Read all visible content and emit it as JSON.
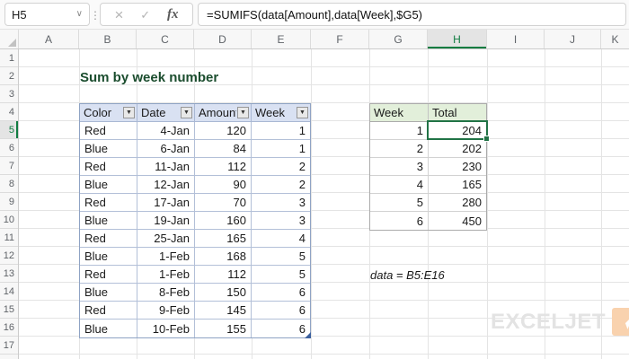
{
  "formula_bar": {
    "name_box_value": "H5",
    "name_box_dropdown_icon": "∨",
    "separator_icon": "⋮",
    "cancel_icon": "×",
    "enter_icon": "✓",
    "fx_icon": "fx",
    "formula": "=SUMIFS(data[Amount],data[Week],$G5)"
  },
  "sheet": {
    "column_headers": [
      "A",
      "B",
      "C",
      "D",
      "E",
      "F",
      "G",
      "H",
      "I",
      "J",
      "K"
    ],
    "selected_column": "H",
    "row_headers": [
      "1",
      "2",
      "3",
      "4",
      "5",
      "6",
      "7",
      "8",
      "9",
      "10",
      "11",
      "12",
      "13",
      "14",
      "15",
      "16",
      "17"
    ],
    "selected_row": "5",
    "active_cell": "H5"
  },
  "content": {
    "title": "Sum by week number",
    "note": "data = B5:E16"
  },
  "data_table": {
    "name": "data",
    "headers": [
      "Color",
      "Date",
      "Amount",
      "Week"
    ],
    "filter_icon": "▼",
    "rows": [
      [
        "Red",
        "4-Jan",
        "120",
        "1"
      ],
      [
        "Blue",
        "6-Jan",
        "84",
        "1"
      ],
      [
        "Red",
        "11-Jan",
        "112",
        "2"
      ],
      [
        "Blue",
        "12-Jan",
        "90",
        "2"
      ],
      [
        "Red",
        "17-Jan",
        "70",
        "3"
      ],
      [
        "Blue",
        "19-Jan",
        "160",
        "3"
      ],
      [
        "Red",
        "25-Jan",
        "165",
        "4"
      ],
      [
        "Blue",
        "1-Feb",
        "168",
        "5"
      ],
      [
        "Red",
        "1-Feb",
        "112",
        "5"
      ],
      [
        "Blue",
        "8-Feb",
        "150",
        "6"
      ],
      [
        "Red",
        "9-Feb",
        "145",
        "6"
      ],
      [
        "Blue",
        "10-Feb",
        "155",
        "6"
      ]
    ]
  },
  "summary_table": {
    "headers": [
      "Week",
      "Total"
    ],
    "rows": [
      [
        "1",
        "204"
      ],
      [
        "2",
        "202"
      ],
      [
        "3",
        "230"
      ],
      [
        "4",
        "165"
      ],
      [
        "5",
        "280"
      ],
      [
        "6",
        "450"
      ]
    ]
  },
  "logo": {
    "text": "EXCELJET"
  },
  "colors": {
    "accent_green": "#217346",
    "selected_header_green": "#107C41",
    "data_table_header_bg": "#D9E1F2",
    "data_table_border": "#8FA3C4",
    "summary_header_bg": "#E2EFDA",
    "title_color": "#1B4D2E",
    "logo_text_color": "#E3E3E3",
    "logo_badge_color": "#F9D2AE",
    "table_resize_handle": "#3A5F9E"
  }
}
